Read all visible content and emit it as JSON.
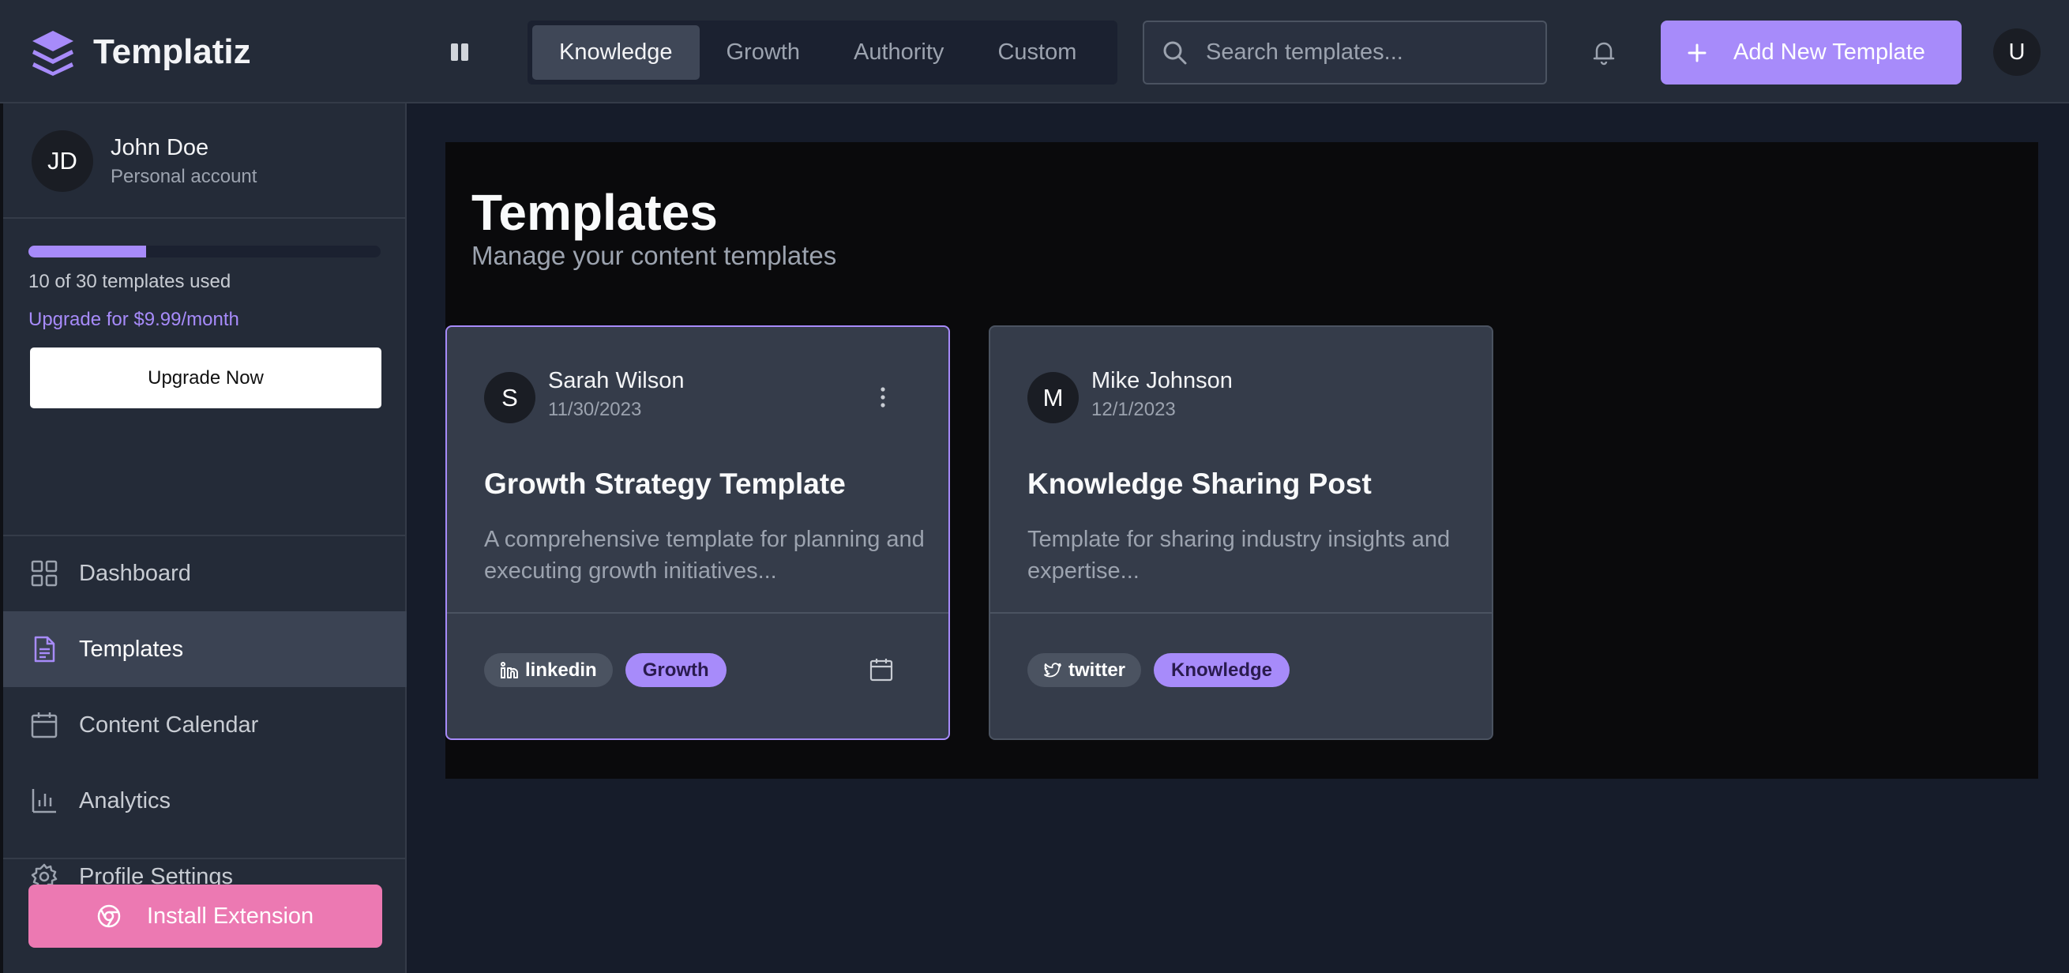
{
  "app": {
    "name": "Templatiz"
  },
  "header": {
    "tabs": [
      {
        "label": "Knowledge",
        "active": true
      },
      {
        "label": "Growth",
        "active": false
      },
      {
        "label": "Authority",
        "active": false
      },
      {
        "label": "Custom",
        "active": false
      }
    ],
    "search_placeholder": "Search templates...",
    "add_button_label": "Add New Template",
    "user_initial": "U"
  },
  "sidebar": {
    "profile": {
      "initials": "JD",
      "name": "John Doe",
      "account_type": "Personal account"
    },
    "usage": {
      "used": 10,
      "total": 30,
      "fraction": 0.333,
      "text": "10 of 30 templates used",
      "upgrade_text": "Upgrade for $9.99/month",
      "upgrade_button": "Upgrade Now"
    },
    "nav": [
      {
        "label": "Dashboard",
        "icon": "grid-icon",
        "active": false
      },
      {
        "label": "Templates",
        "icon": "document-icon",
        "active": true
      },
      {
        "label": "Content Calendar",
        "icon": "calendar-icon",
        "active": false
      },
      {
        "label": "Analytics",
        "icon": "bar-chart-icon",
        "active": false
      },
      {
        "label": "Profile Settings",
        "icon": "gear-icon",
        "active": false
      }
    ],
    "install_button": "Install Extension"
  },
  "main": {
    "title": "Templates",
    "subtitle": "Manage your content templates",
    "cards": [
      {
        "initial": "S",
        "author": "Sarah Wilson",
        "date": "11/30/2023",
        "title": "Growth Strategy Template",
        "description": "A comprehensive template for planning and executing growth initiatives...",
        "platform": "linkedin",
        "category": "Growth",
        "selected": true
      },
      {
        "initial": "M",
        "author": "Mike Johnson",
        "date": "12/1/2023",
        "title": "Knowledge Sharing Post",
        "description": "Template for sharing industry insights and expertise...",
        "platform": "twitter",
        "category": "Knowledge",
        "selected": false
      }
    ]
  },
  "colors": {
    "accent": "#a78bfa",
    "install": "#ec79b2",
    "background": "#161c2a",
    "surface": "#242b38"
  }
}
